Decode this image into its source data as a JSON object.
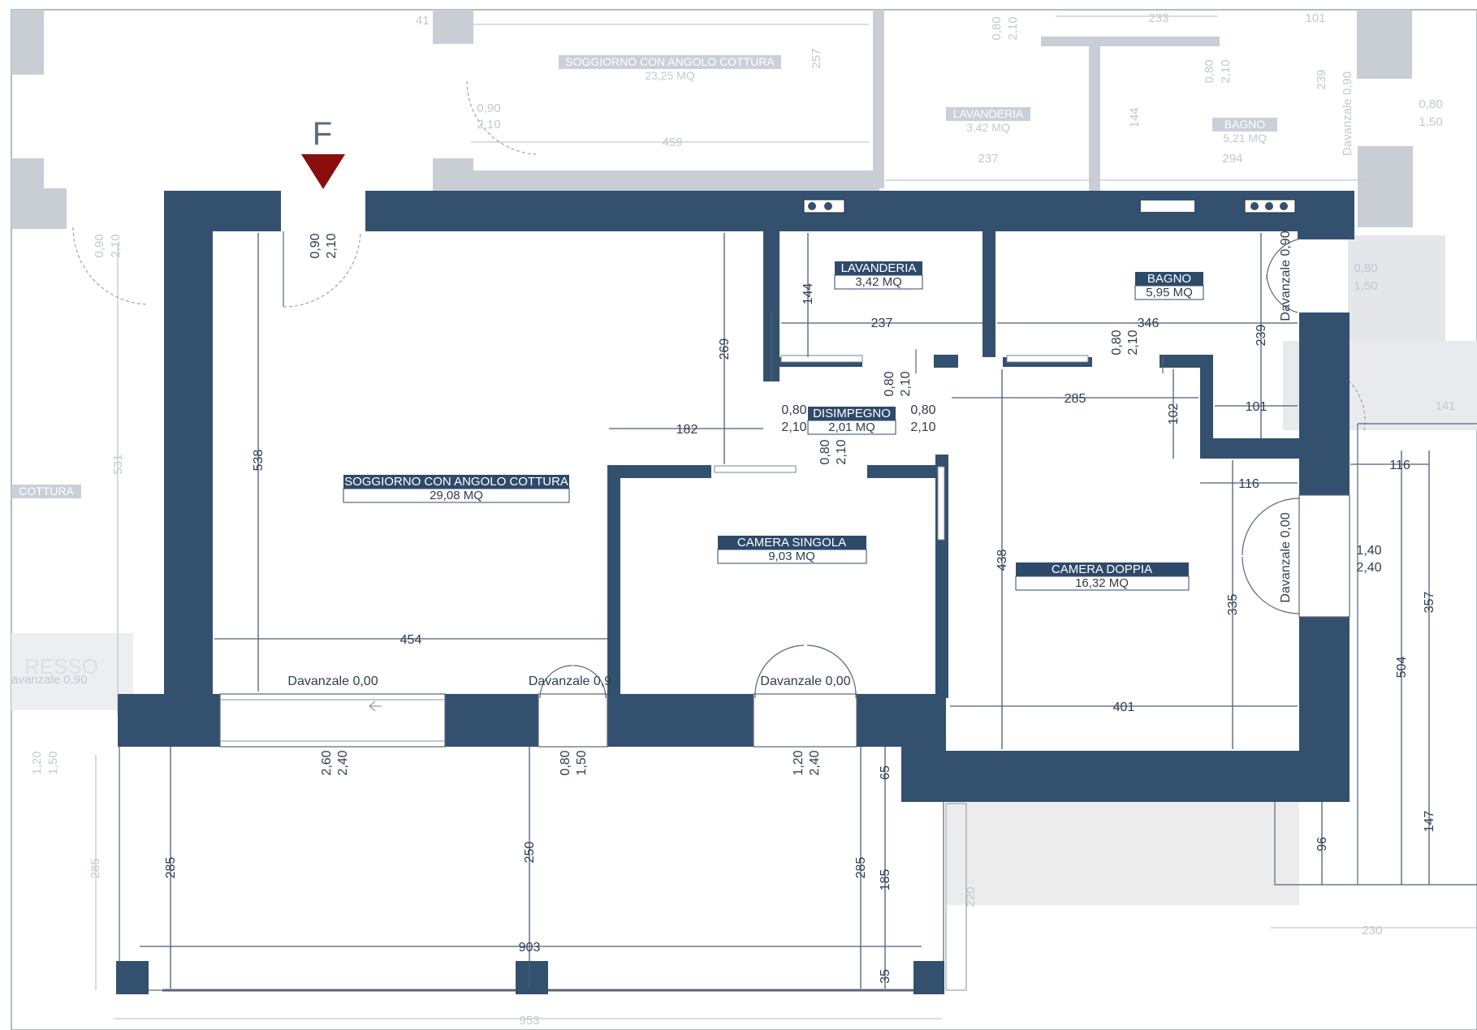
{
  "marker": "F",
  "rooms": {
    "soggiorno": {
      "name": "SOGGIORNO CON ANGOLO COTTURA",
      "area": "29,08 MQ"
    },
    "lavanderia": {
      "name": "LAVANDERIA",
      "area": "3,42 MQ"
    },
    "bagno": {
      "name": "BAGNO",
      "area": "5,95 MQ"
    },
    "disimpegno": {
      "name": "DISIMPEGNO",
      "area": "2,01 MQ"
    },
    "camera_singola": {
      "name": "CAMERA SINGOLA",
      "area": "9,03 MQ"
    },
    "camera_doppia": {
      "name": "CAMERA DOPPIA",
      "area": "16,32 MQ"
    }
  },
  "ghost_rooms": {
    "soggiorno": {
      "name": "SOGGIORNO CON ANGOLO COTTURA",
      "area": "23,25 MQ"
    },
    "lavanderia": {
      "name": "LAVANDERIA",
      "area": "3,42 MQ"
    },
    "bagno": {
      "name": "BAGNO",
      "area": "5,21 MQ"
    },
    "cottura": {
      "name": "COTTURA"
    },
    "ingresso": {
      "name": "RESSO"
    }
  },
  "dimensions": {
    "d538": "538",
    "d269": "269",
    "d144": "144",
    "d237": "237",
    "d346": "346",
    "d239": "239",
    "d285a": "285",
    "d102": "102",
    "d101": "101",
    "d182": "182",
    "d116a": "116",
    "d116b": "116",
    "d438": "438",
    "d335": "335",
    "d454": "454",
    "d401": "401",
    "d504": "504",
    "d357": "357",
    "d147": "147",
    "d96": "96",
    "d285b": "285",
    "d250": "250",
    "d285c": "285",
    "d65": "65",
    "d185": "185",
    "d35": "35",
    "d903": "903"
  },
  "openings": {
    "door_entry_w": "0,90",
    "door_entry_h": "2,10",
    "door_lav_w": "0,80",
    "door_lav_h": "2,10",
    "door_bagno_w": "0,80",
    "door_bagno_h": "2,10",
    "door_left_w": "0,80",
    "door_left_h": "2,10",
    "door_right_w": "0,80",
    "door_right_h": "2,10",
    "door_cs_w": "0,80",
    "door_cs_h": "2,10",
    "win_sog_w": "2,60",
    "win_sog_h": "2,40",
    "win_mid_w": "0,80",
    "win_mid_h": "1,50",
    "win_cs_w": "1,20",
    "win_cs_h": "2,40",
    "win_cd_w": "1,40",
    "win_cd_h": "2,40",
    "sill_sog": "Davanzale 0,00",
    "sill_mid": "Davanzale 0,9",
    "sill_cs": "Davanzale 0,00",
    "sill_cd": "Davanzale 0,00",
    "sill_bagno": "Davanzale 0,90"
  },
  "ghost_dimensions": {
    "g41": "41",
    "g257": "257",
    "g459": "459",
    "g233": "233",
    "g101": "101",
    "g237": "237",
    "g294": "294",
    "g144": "144",
    "g239": "239",
    "g080a": "0,80",
    "g210a": "2,10",
    "g080b": "0,80",
    "g210b": "2,10",
    "g090": "0,90",
    "g210c": "2,10",
    "g090b": "0,90",
    "g210d": "2,10",
    "g531": "531",
    "g080c": "0,80",
    "g150": "1,50",
    "g141": "141",
    "g230": "230",
    "g953": "953",
    "g220": "220",
    "g285": "285",
    "g120": "1,20",
    "g150b": "1,50",
    "gdav": "Davanzale 0,90",
    "gdav2": "avanzale 0,90"
  },
  "colors": {
    "wall": "#34506f",
    "marker": "#8b0e0e",
    "label": "#2e4a6b"
  }
}
